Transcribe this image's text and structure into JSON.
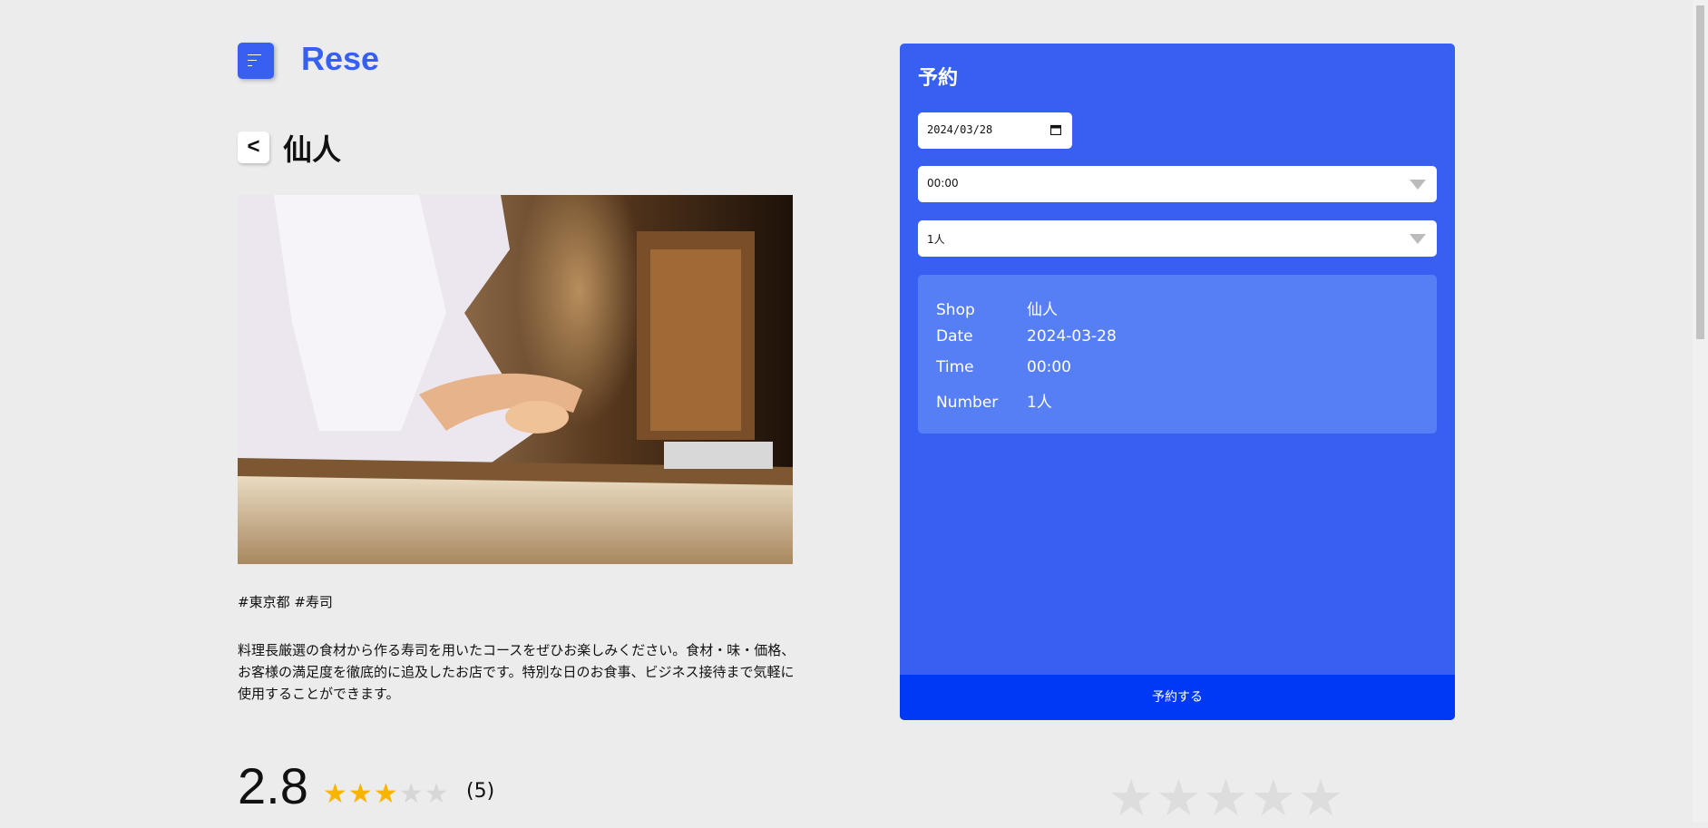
{
  "header": {
    "logo_text": "Rese"
  },
  "shop": {
    "back_label": "<",
    "name": "仙人",
    "tags": "#東京都 #寿司",
    "description": "料理長厳選の食材から作る寿司を用いたコースをぜひお楽しみください。食材・味・価格、お客様の満足度を徹底的に追及したお店です。特別な日のお食事、ビジネス接待まで気軽に使用することができます。"
  },
  "rating": {
    "average": "2.8",
    "filled_stars": 3,
    "total_stars": 5,
    "count_label": "(5)",
    "star_color": "#f7b500",
    "empty_star_color": "#d7d7d7"
  },
  "reservation": {
    "title": "予約",
    "date_value": "2024/03/28",
    "time_value": "00:00",
    "number_value": "1人",
    "summary": {
      "shop_label": "Shop",
      "shop_value": "仙人",
      "date_label": "Date",
      "date_value": "2024-03-28",
      "time_label": "Time",
      "time_value": "00:00",
      "number_label": "Number",
      "number_value": "1人"
    },
    "submit_label": "予約する"
  },
  "colors": {
    "accent": "#3760f2",
    "submit": "#0039f5",
    "summary_bg": "#577ff5",
    "page_bg": "#ececec"
  }
}
